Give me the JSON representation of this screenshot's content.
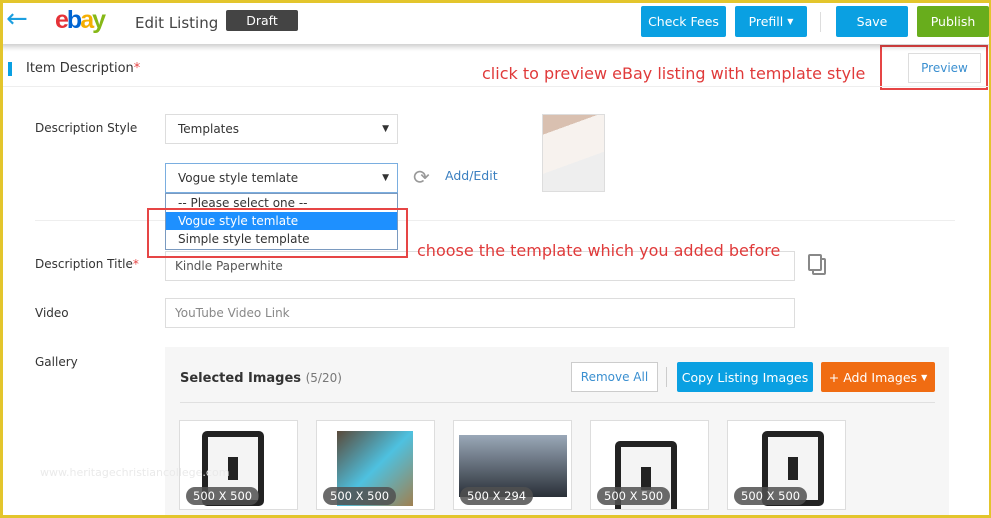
{
  "header": {
    "title": "Edit Listing",
    "status": "Draft",
    "logo": "ebay",
    "buttons": {
      "check_fees": "Check Fees",
      "prefill": "Prefill",
      "save": "Save",
      "publish": "Publish"
    }
  },
  "section": {
    "title": "Item Description",
    "required": "*",
    "preview": "Preview"
  },
  "annotations": {
    "preview": "click to preview eBay listing with template style",
    "template": "choose the template which you added before"
  },
  "form": {
    "description_style": {
      "label": "Description Style",
      "value": "Templates"
    },
    "template": {
      "value": "Vogue style temlate",
      "options": [
        "-- Please select one --",
        "Vogue style temlate",
        "Simple style template"
      ],
      "selected_index": 1,
      "add_edit": "Add/Edit"
    },
    "description_title": {
      "label": "Description Title",
      "required": "*",
      "value": "Kindle Paperwhite"
    },
    "video": {
      "label": "Video",
      "placeholder": "YouTube Video Link"
    },
    "gallery": {
      "label": "Gallery",
      "selected_label": "Selected Images",
      "count": "(5/20)",
      "remove_all": "Remove All",
      "copy": "Copy Listing Images",
      "add": "+ Add Images",
      "images": [
        {
          "size": "500 X 500"
        },
        {
          "size": "500 X 500"
        },
        {
          "size": "500 X 294"
        },
        {
          "size": "500 X 500"
        },
        {
          "size": "500 X 500"
        }
      ]
    }
  },
  "watermark": "www.heritagechristiancollege.com",
  "colors": {
    "accent": "#0aa0e2",
    "publish": "#68ad1c",
    "addImages": "#f06c12",
    "annotation": "#e03a3a"
  }
}
